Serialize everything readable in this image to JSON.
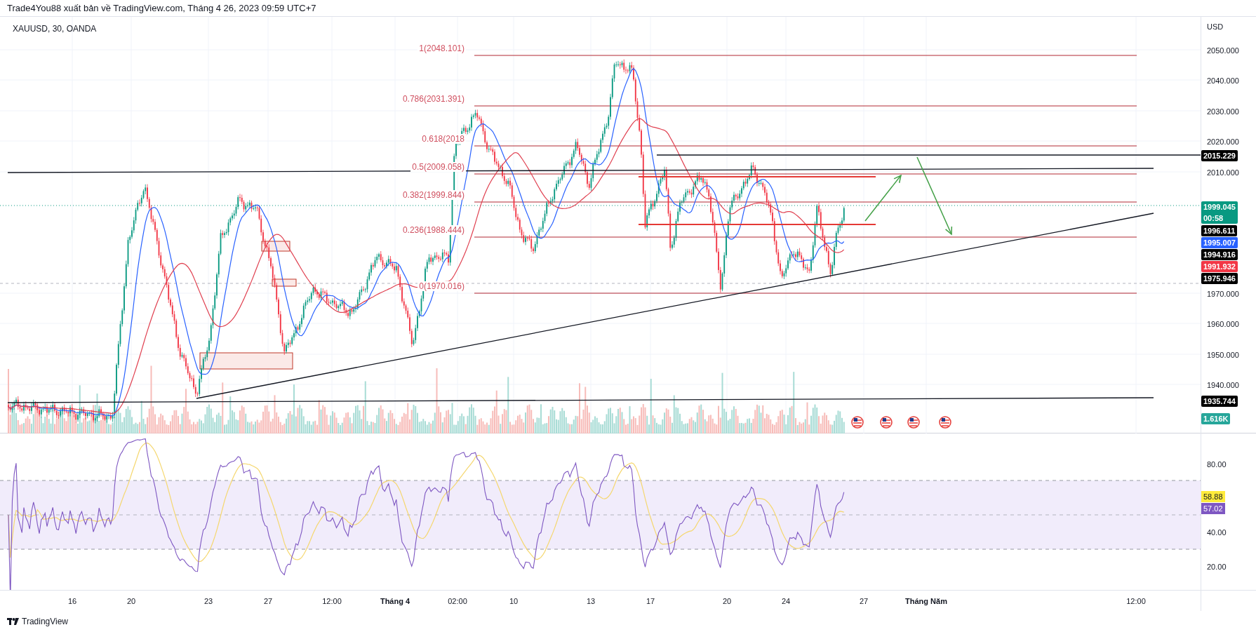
{
  "header": {
    "text": "Trade4You88 xuất bản về TradingView.com, Tháng 4 26, 2023 09:59 UTC+7"
  },
  "chart": {
    "symbol": "XAUUSD, 30, OANDA",
    "currency": "USD",
    "fib_levels": [
      "1(2048.101)",
      "0.786(2031.391)",
      "0.618(2018",
      "0.5(2009.058)",
      "0.382(1999.844)",
      "0.236(1988.444)",
      "0(1970.016)"
    ],
    "price_ticks": [
      "2050.000",
      "2040.000",
      "2030.000",
      "2020.000",
      "2010.000",
      "1970.000",
      "1960.000",
      "1950.000",
      "1940.000"
    ],
    "price_tags": [
      {
        "text": "2015.229",
        "color": "#000000"
      },
      {
        "text": "1999.045",
        "sub": "00:58",
        "color": "#089981"
      },
      {
        "text": "1996.611",
        "color": "#000000"
      },
      {
        "text": "1995.007",
        "color": "#2962ff"
      },
      {
        "text": "1994.916",
        "color": "#000000"
      },
      {
        "text": "1991.932",
        "color": "#f23645"
      },
      {
        "text": "1975.946",
        "color": "#000000"
      },
      {
        "text": "1935.744",
        "color": "#000000"
      },
      {
        "text": "1.616K",
        "color": "#26a69a"
      }
    ]
  },
  "rsi": {
    "ticks": [
      "80.00",
      "40.00",
      "20.00"
    ],
    "tags": [
      {
        "text": "58.88",
        "color": "#ffeb3b"
      },
      {
        "text": "57.02",
        "color": "#7e57c2"
      }
    ]
  },
  "x_axis": [
    {
      "text": "16",
      "kind": "day"
    },
    {
      "text": "20",
      "kind": "day"
    },
    {
      "text": "23",
      "kind": "day"
    },
    {
      "text": "27",
      "kind": "day"
    },
    {
      "text": "12:00",
      "kind": "day"
    },
    {
      "text": "Tháng 4",
      "kind": "month"
    },
    {
      "text": "02:00",
      "kind": "day"
    },
    {
      "text": "10",
      "kind": "day"
    },
    {
      "text": "13",
      "kind": "day"
    },
    {
      "text": "17",
      "kind": "day"
    },
    {
      "text": "20",
      "kind": "day"
    },
    {
      "text": "24",
      "kind": "day"
    },
    {
      "text": "27",
      "kind": "day"
    },
    {
      "text": "Tháng Năm",
      "kind": "month"
    },
    {
      "text": "12:00",
      "kind": "day"
    }
  ],
  "footer": {
    "brand": "TradingView"
  }
}
